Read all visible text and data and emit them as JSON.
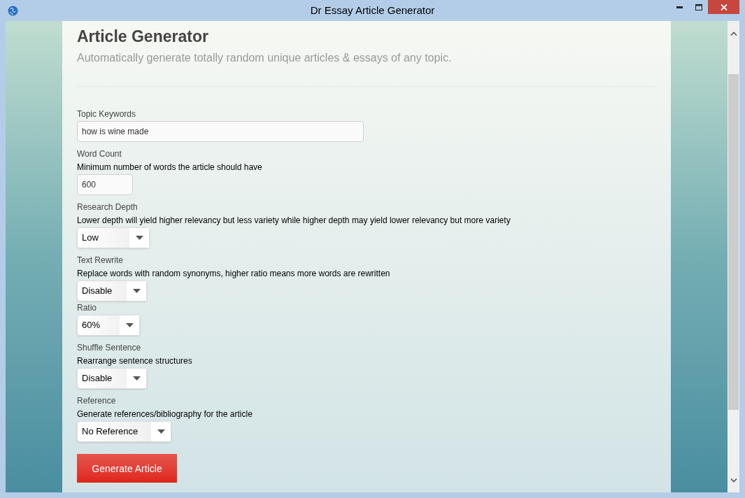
{
  "window": {
    "title": "Dr Essay Article Generator"
  },
  "header": {
    "title": "Article Generator",
    "subtitle": "Automatically generate totally random unique articles & essays of any topic."
  },
  "fields": [
    {
      "kind": "text",
      "label": "Topic Keywords",
      "value": "how is wine made"
    },
    {
      "kind": "number",
      "label": "Word Count",
      "description": "Minimum number of words the article should have",
      "value": "600"
    },
    {
      "kind": "select",
      "label": "Research Depth",
      "description": "Lower depth will yield higher relevancy but less variety while higher depth may yield lower relevancy but more variety",
      "value": "Low"
    },
    {
      "kind": "select",
      "label": "Text Rewrite",
      "description": "Replace words with random synonyms, higher ratio means more words are rewritten",
      "value": "Disable",
      "sub_fields": [
        {
          "kind": "select",
          "label": "Ratio",
          "value": "60%"
        }
      ]
    },
    {
      "kind": "select",
      "label": "Shuffle Sentence",
      "description": "Rearrange sentence structures",
      "value": "Disable"
    },
    {
      "kind": "select",
      "label": "Reference",
      "description": "Generate references/bibliography for the article",
      "value": "No Reference"
    }
  ],
  "submit_button": "Generate Article"
}
